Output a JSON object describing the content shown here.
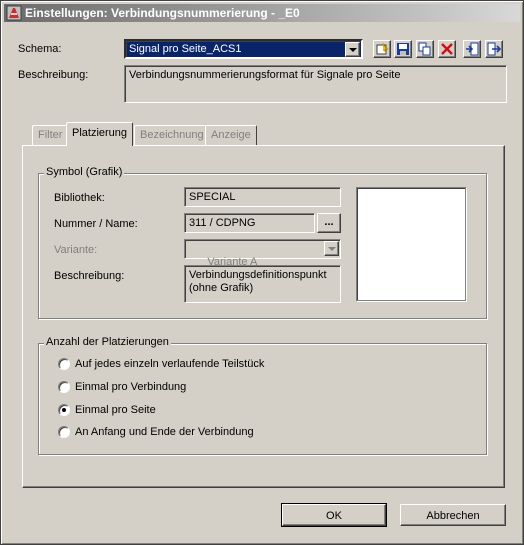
{
  "window": {
    "title": "Einstellungen: Verbindungsnummerierung - _E0"
  },
  "schema": {
    "label": "Schema:",
    "value": "Signal pro Seite_ACS1",
    "toolbar": [
      "new-icon",
      "save-icon",
      "copy-icon",
      "delete-icon",
      "import-icon",
      "export-icon"
    ]
  },
  "description": {
    "label": "Beschreibung:",
    "value": "Verbindungsnummerierungsformat für Signale pro Seite"
  },
  "tabs": [
    {
      "label": "Filter",
      "active": false
    },
    {
      "label": "Platzierung",
      "active": true
    },
    {
      "label": "Bezeichnung",
      "active": false
    },
    {
      "label": "Anzeige",
      "active": false
    }
  ],
  "symbol_group": {
    "title": "Symbol (Grafik)",
    "library_label": "Bibliothek:",
    "library_value": "SPECIAL",
    "number_label": "Nummer / Name:",
    "number_value": "311 / CDPNG",
    "browse_label": "...",
    "variant_label": "Variante:",
    "variant_value": "Variante A",
    "desc_label": "Beschreibung:",
    "desc_value": "Verbindungsdefinitionspunkt\n(ohne Grafik)"
  },
  "placement_group": {
    "title": "Anzahl der Platzierungen",
    "options": [
      {
        "label": "Auf jedes einzeln verlaufende Teilstück",
        "selected": false
      },
      {
        "label": "Einmal pro Verbindung",
        "selected": false
      },
      {
        "label": "Einmal pro Seite",
        "selected": true
      },
      {
        "label": "An Anfang und Ende der Verbindung",
        "selected": false
      }
    ]
  },
  "buttons": {
    "ok": "OK",
    "cancel": "Abbrechen"
  },
  "colors": {
    "face": "#d4d0c8",
    "selection": "#0a246a",
    "title_gradient_start": "#6b6b6b"
  }
}
